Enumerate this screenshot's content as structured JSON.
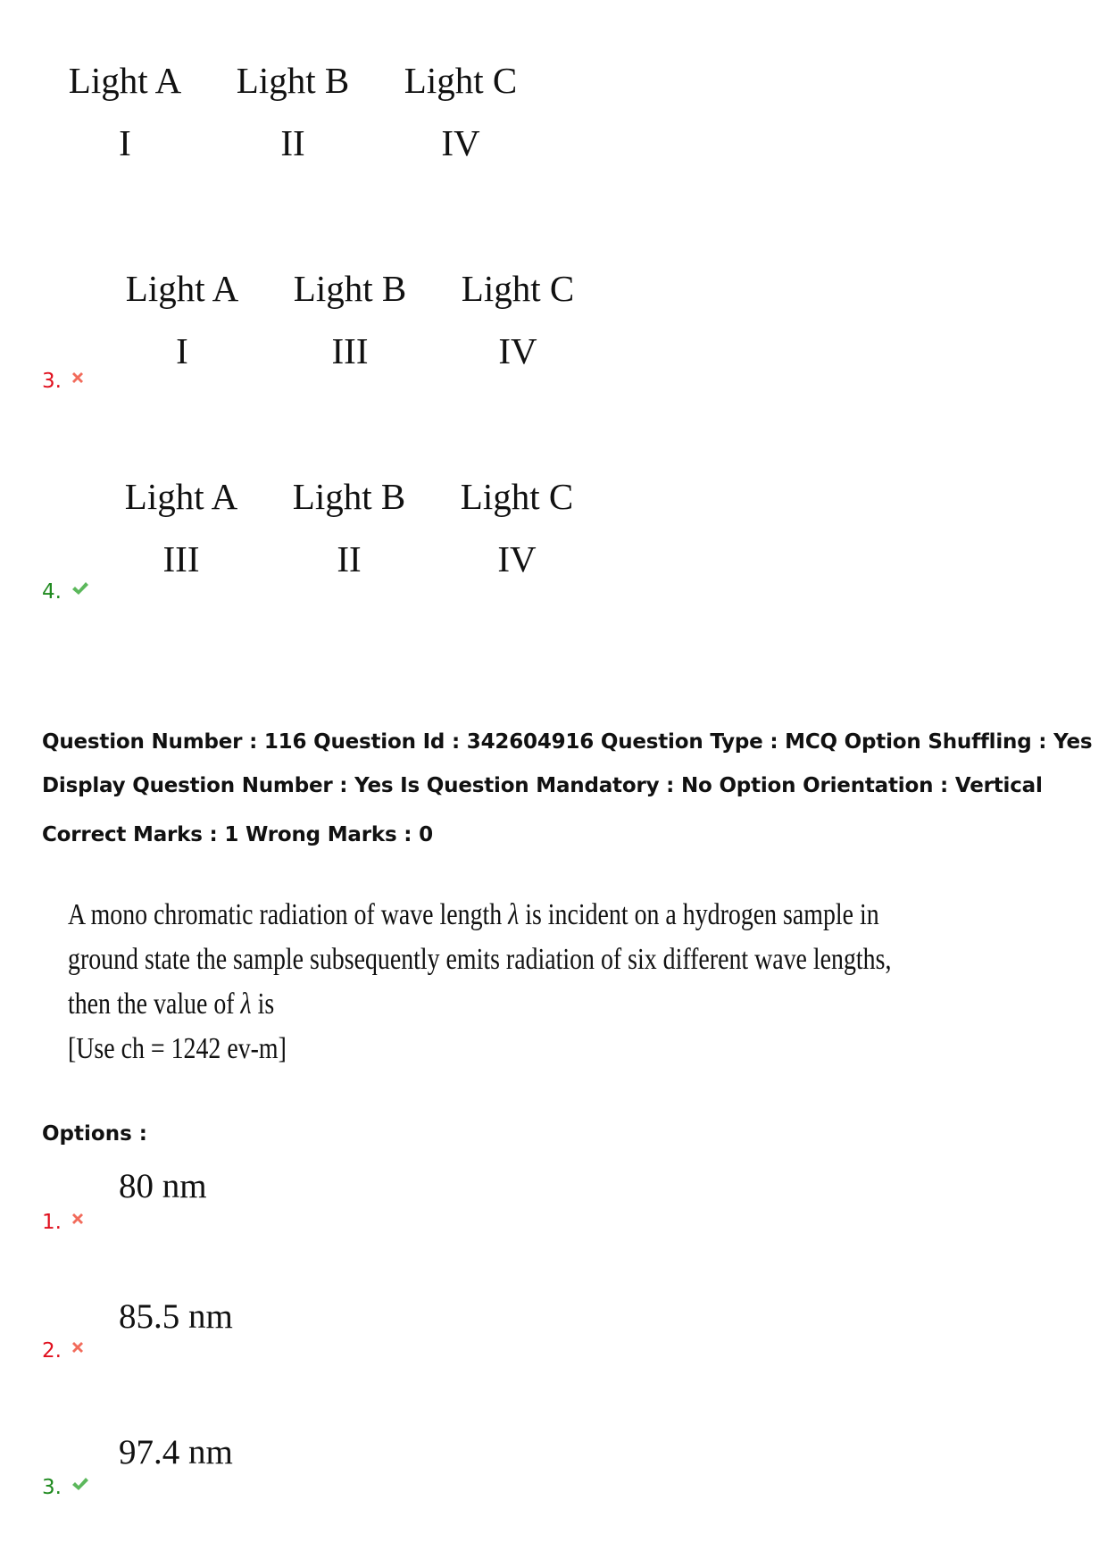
{
  "previous_question_options": [
    {
      "number": "",
      "status": "none",
      "headers": [
        "Light A",
        "Light B",
        "Light C"
      ],
      "values": [
        "I",
        "II",
        "IV"
      ]
    },
    {
      "number": "3.",
      "status": "wrong",
      "icon": "cross-icon",
      "headers": [
        "Light A",
        "Light B",
        "Light C"
      ],
      "values": [
        "I",
        "III",
        "IV"
      ]
    },
    {
      "number": "4.",
      "status": "correct",
      "icon": "check-icon",
      "headers": [
        "Light A",
        "Light B",
        "Light C"
      ],
      "values": [
        "III",
        "II",
        "IV"
      ]
    }
  ],
  "question_meta": {
    "line1": "Question Number : 116 Question Id : 342604916 Question Type : MCQ Option Shuffling : Yes",
    "line2": "Display Question Number : Yes Is Question Mandatory : No Option Orientation : Vertical",
    "line3": "Correct Marks : 1 Wrong Marks : 0"
  },
  "question": {
    "line1_a": "A mono chromatic radiation of wave length ",
    "lambda": "λ",
    "line1_b": " is incident on a hydrogen sample in",
    "line2": "ground state the sample subsequently emits radiation of six different wave lengths,",
    "line3_a": "then the value of ",
    "line3_b": " is",
    "line4": "[Use ch = 1242 ev-m]"
  },
  "options_label": "Options :",
  "options": [
    {
      "number": "1.",
      "status": "wrong",
      "icon": "cross-icon",
      "value": "80 nm"
    },
    {
      "number": "2.",
      "status": "wrong",
      "icon": "cross-icon",
      "value": "85.5 nm"
    },
    {
      "number": "3.",
      "status": "correct",
      "icon": "check-icon",
      "value": "97.4 nm"
    }
  ],
  "colors": {
    "wrong": "#e0101e",
    "correct": "#1f8a1f",
    "cross_icon": "#f26b5b",
    "check_icon": "#5cb85c"
  }
}
